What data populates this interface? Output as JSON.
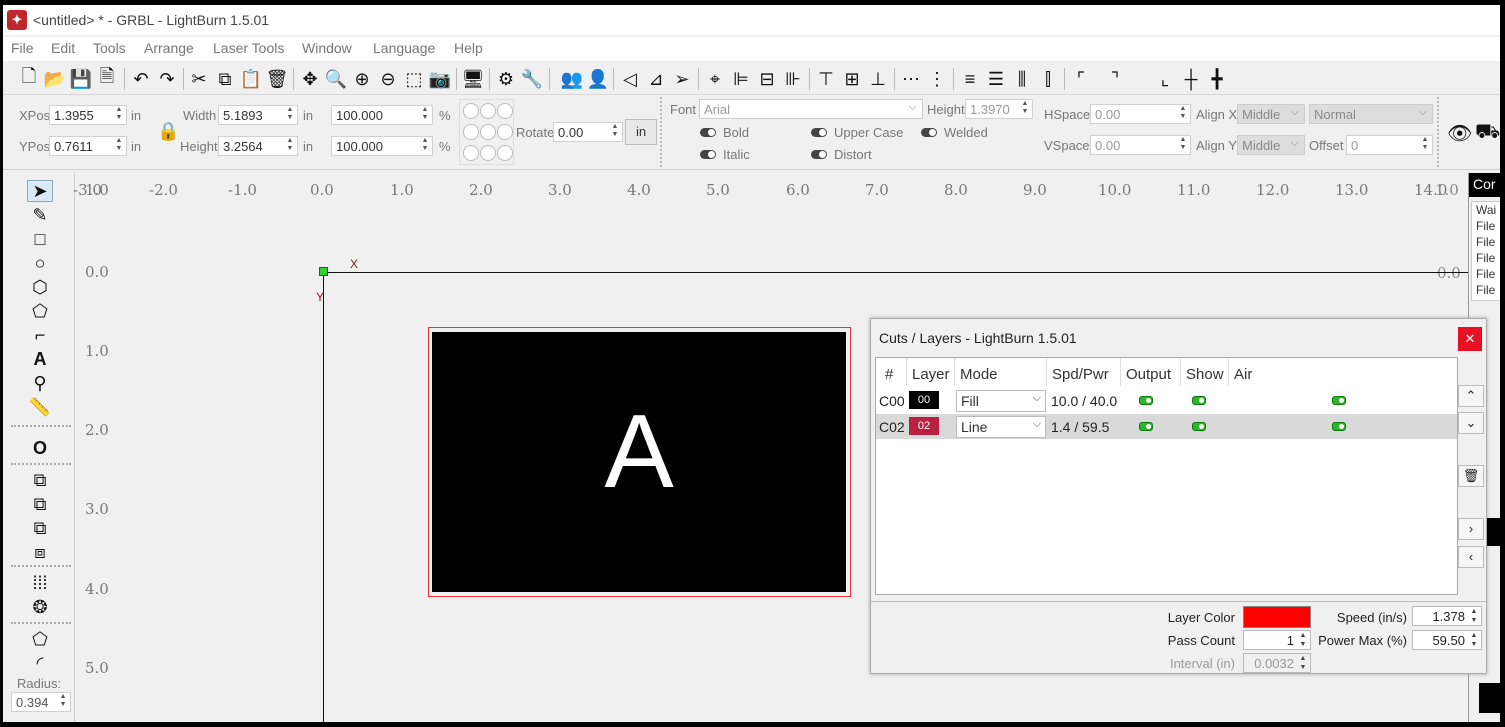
{
  "window": {
    "title": "<untitled> * - GRBL - LightBurn 1.5.01"
  },
  "menu": [
    "File",
    "Edit",
    "Tools",
    "Arrange",
    "Laser Tools",
    "Window",
    "Language",
    "Help"
  ],
  "numeric": {
    "xpos_label": "XPos",
    "xpos": "1.3955",
    "ypos_label": "YPos",
    "ypos": "0.7611",
    "width_label": "Width",
    "width": "5.1893",
    "height_label": "Height",
    "height": "3.2564",
    "unit": "in",
    "scale_w": "100.000",
    "scale_h": "100.000",
    "pct": "%",
    "rotate_label": "Rotate",
    "rotate": "0.00",
    "unit_button": "in"
  },
  "text_tools": {
    "font_label": "Font",
    "font": "Arial",
    "height_label": "Height",
    "height": "1.3970",
    "hspace_label": "HSpace",
    "hspace": "0.00",
    "vspace_label": "VSpace",
    "vspace": "0.00",
    "alignx_label": "Align X",
    "alignx": "Middle",
    "aligny_label": "Align Y",
    "aligny": "Middle",
    "style": "Normal",
    "offset_label": "Offset",
    "offset": "0",
    "bold": "Bold",
    "italic": "Italic",
    "upper": "Upper Case",
    "distort": "Distort",
    "welded": "Welded"
  },
  "ruler": {
    "x": [
      "-3.0",
      "-2.0",
      "-1.0",
      "0.0",
      "1.0",
      "2.0",
      "3.0",
      "4.0",
      "5.0",
      "6.0",
      "7.0",
      "8.0",
      "9.0",
      "10.0",
      "11.0",
      "12.0",
      "13.0",
      "14.0"
    ],
    "y": [
      "1.0",
      "0.0",
      "1.0",
      "2.0",
      "3.0",
      "4.0",
      "5.0"
    ],
    "right_top": "1.0",
    "right_zero": "0.0",
    "axis_x": "X",
    "axis_y": "Y"
  },
  "design": {
    "letter": "A"
  },
  "left": {
    "radius_label": "Radius:",
    "radius": "0.394"
  },
  "cuts": {
    "title": "Cuts / Layers - LightBurn 1.5.01",
    "headers": [
      "#",
      "Layer",
      "Mode",
      "Spd/Pwr",
      "Output",
      "Show",
      "Air"
    ],
    "rows": [
      {
        "id": "C00",
        "layer": "00",
        "color": "#000000",
        "mode": "Fill",
        "spdpwr": "10.0 / 40.0"
      },
      {
        "id": "C02",
        "layer": "02",
        "color": "#b8213f",
        "mode": "Line",
        "spdpwr": "1.4 / 59.5"
      }
    ],
    "layer_color_label": "Layer Color",
    "layer_color": "#ff0000",
    "pass_count_label": "Pass Count",
    "pass_count": "1",
    "interval_label": "Interval (in)",
    "interval": "0.0032",
    "speed_label": "Speed (in/s)",
    "speed": "1.378",
    "power_label": "Power Max (%)",
    "power": "59.50"
  },
  "right_panel": {
    "title": "Cor",
    "lines": [
      "Wai",
      "File",
      "File",
      "File",
      "File",
      "File"
    ]
  }
}
